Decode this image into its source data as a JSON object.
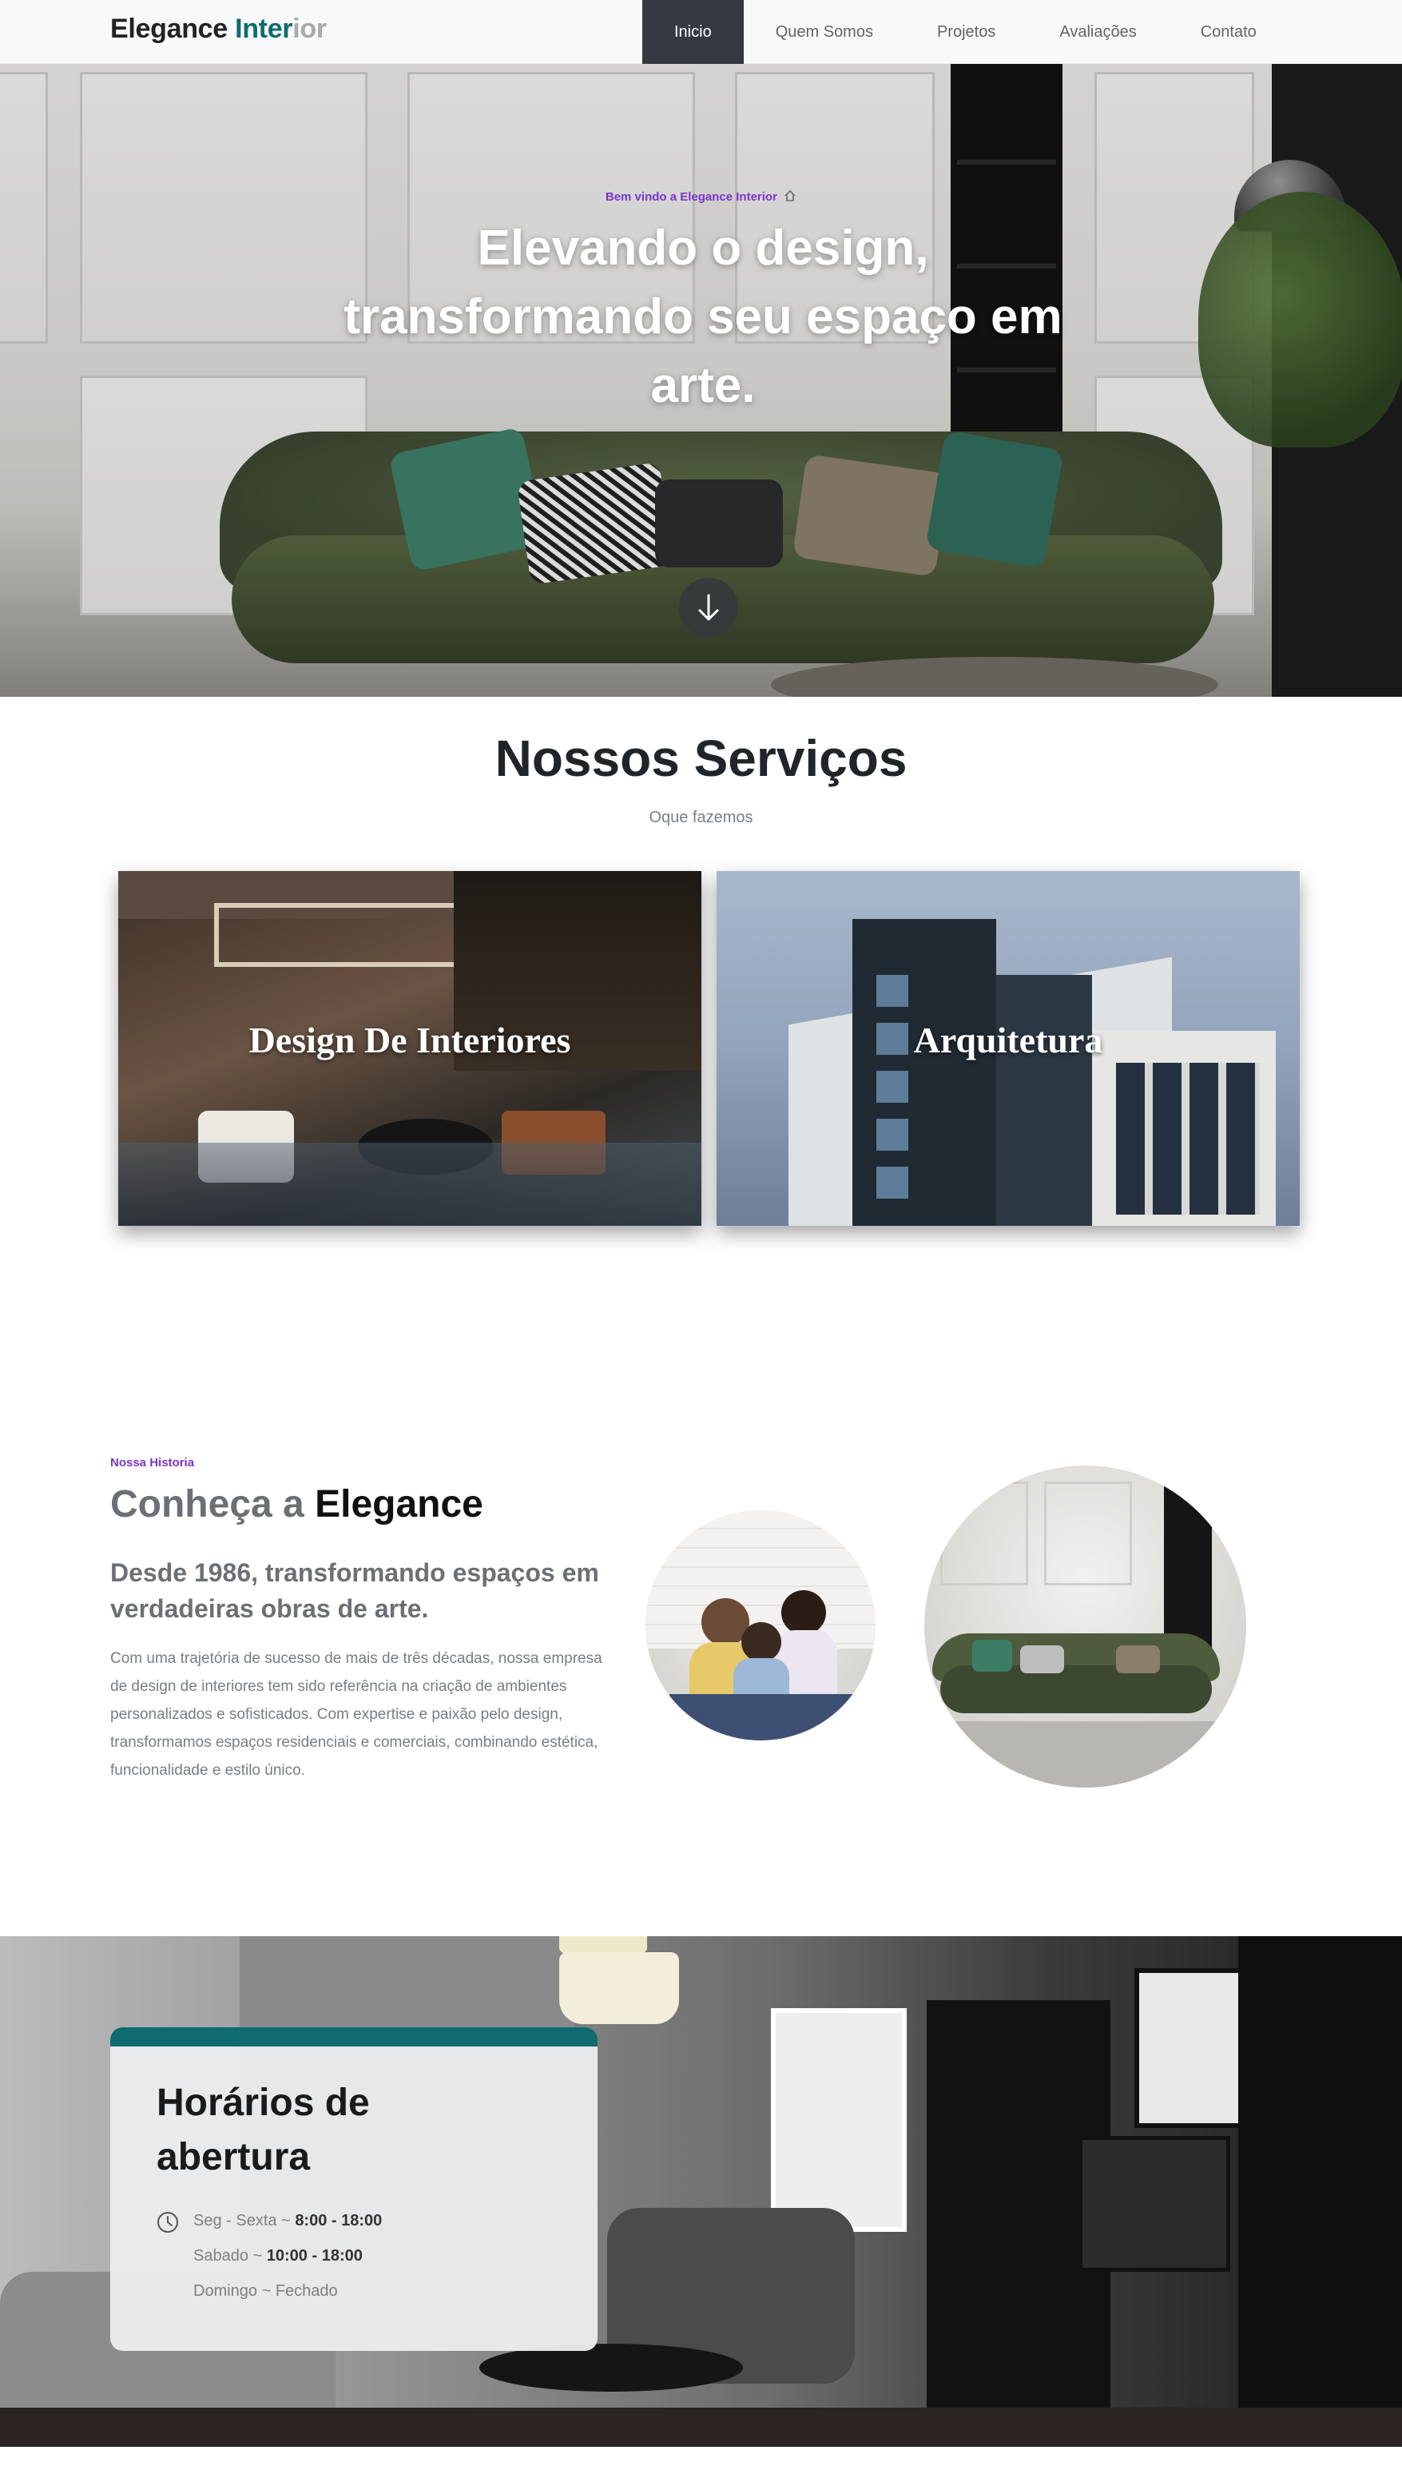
{
  "brand": {
    "part1": "Elegance",
    "part2": "Inter",
    "part3": "ior",
    "colors": {
      "dark": "#1f2326",
      "teal": "#0f6b70",
      "grey": "#a7aaad",
      "accent": "#7a35c9"
    }
  },
  "nav": {
    "items": [
      {
        "label": "Inicio",
        "active": true
      },
      {
        "label": "Quem Somos",
        "active": false
      },
      {
        "label": "Projetos",
        "active": false
      },
      {
        "label": "Avaliações",
        "active": false
      },
      {
        "label": "Contato",
        "active": false
      }
    ]
  },
  "hero": {
    "tagline": "Bem vindo a Elegance Interior",
    "tagline_icon": "house-icon",
    "title": "Elevando o design, transformando seu espaço em arte.",
    "scroll_icon": "arrow-down-icon"
  },
  "services": {
    "title": "Nossos Serviços",
    "subtitle": "Oque fazemos",
    "cards": [
      {
        "label": "Design De Interiores"
      },
      {
        "label": "Arquitetura"
      }
    ]
  },
  "about": {
    "tag": "Nossa Historia",
    "title_prefix": "Conheça a",
    "title_highlight": "Elegance",
    "subtitle": "Desde 1986, transformando espaços em verdadeiras obras de arte.",
    "text": "Com uma trajetória de sucesso de mais de três décadas, nossa empresa de design de interiores tem sido referência na criação de ambientes personalizados e sofisticados. Com expertise e paixão pelo design, transformamos espaços residenciais e comerciais, combinando estética, funcionalidade e estilo único."
  },
  "hours": {
    "title": "Horários de abertura",
    "clock_icon": "clock-icon",
    "rows": [
      {
        "day": "Seg - Sexta ~",
        "time": "8:00 - 18:00"
      },
      {
        "day": "Sabado ~",
        "time": "10:00 - 18:00"
      },
      {
        "day": "Domingo ~ Fechado",
        "time": ""
      }
    ]
  }
}
